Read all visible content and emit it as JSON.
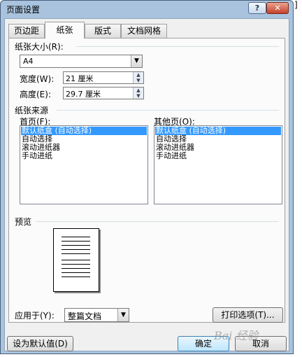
{
  "window": {
    "title": "页面设置"
  },
  "titlebar": {
    "help_glyph": "?",
    "close_glyph": "✕"
  },
  "background": {
    "right_edge_char": "]"
  },
  "tabs": [
    {
      "label": "页边距",
      "active": false
    },
    {
      "label": "纸张",
      "active": true
    },
    {
      "label": "版式",
      "active": false
    },
    {
      "label": "文档网格",
      "active": false
    }
  ],
  "paper_size": {
    "group_label": "纸张大小(R):",
    "selected": "A4",
    "width_label": "宽度(W):",
    "width_value": "21 厘米",
    "height_label": "高度(E):",
    "height_value": "29.7 厘米"
  },
  "paper_source": {
    "group_label": "纸张来源",
    "first_page_label": "首页(F):",
    "other_pages_label": "其他页(O):",
    "first_page_items": [
      "默认纸盒 (自动选择)",
      "自动选择",
      "滚动进纸器",
      "手动进纸"
    ],
    "other_pages_items": [
      "默认纸盒 (自动选择)",
      "自动选择",
      "滚动进纸器",
      "手动进纸"
    ],
    "selected_index": 0
  },
  "preview": {
    "label": "预览"
  },
  "apply_to": {
    "label": "应用于(Y):",
    "selected": "整篇文档"
  },
  "buttons": {
    "print_options": "打印选项(T)...",
    "set_default": "设为默认值(D)",
    "ok": "确定",
    "cancel": "取消"
  },
  "watermark": {
    "text": "Bai 经验"
  },
  "icons": {
    "help": "help-icon",
    "close": "close-icon",
    "dropdown": "chevron-down-icon",
    "spin_up": "spin-up-icon",
    "spin_down": "spin-down-icon"
  }
}
